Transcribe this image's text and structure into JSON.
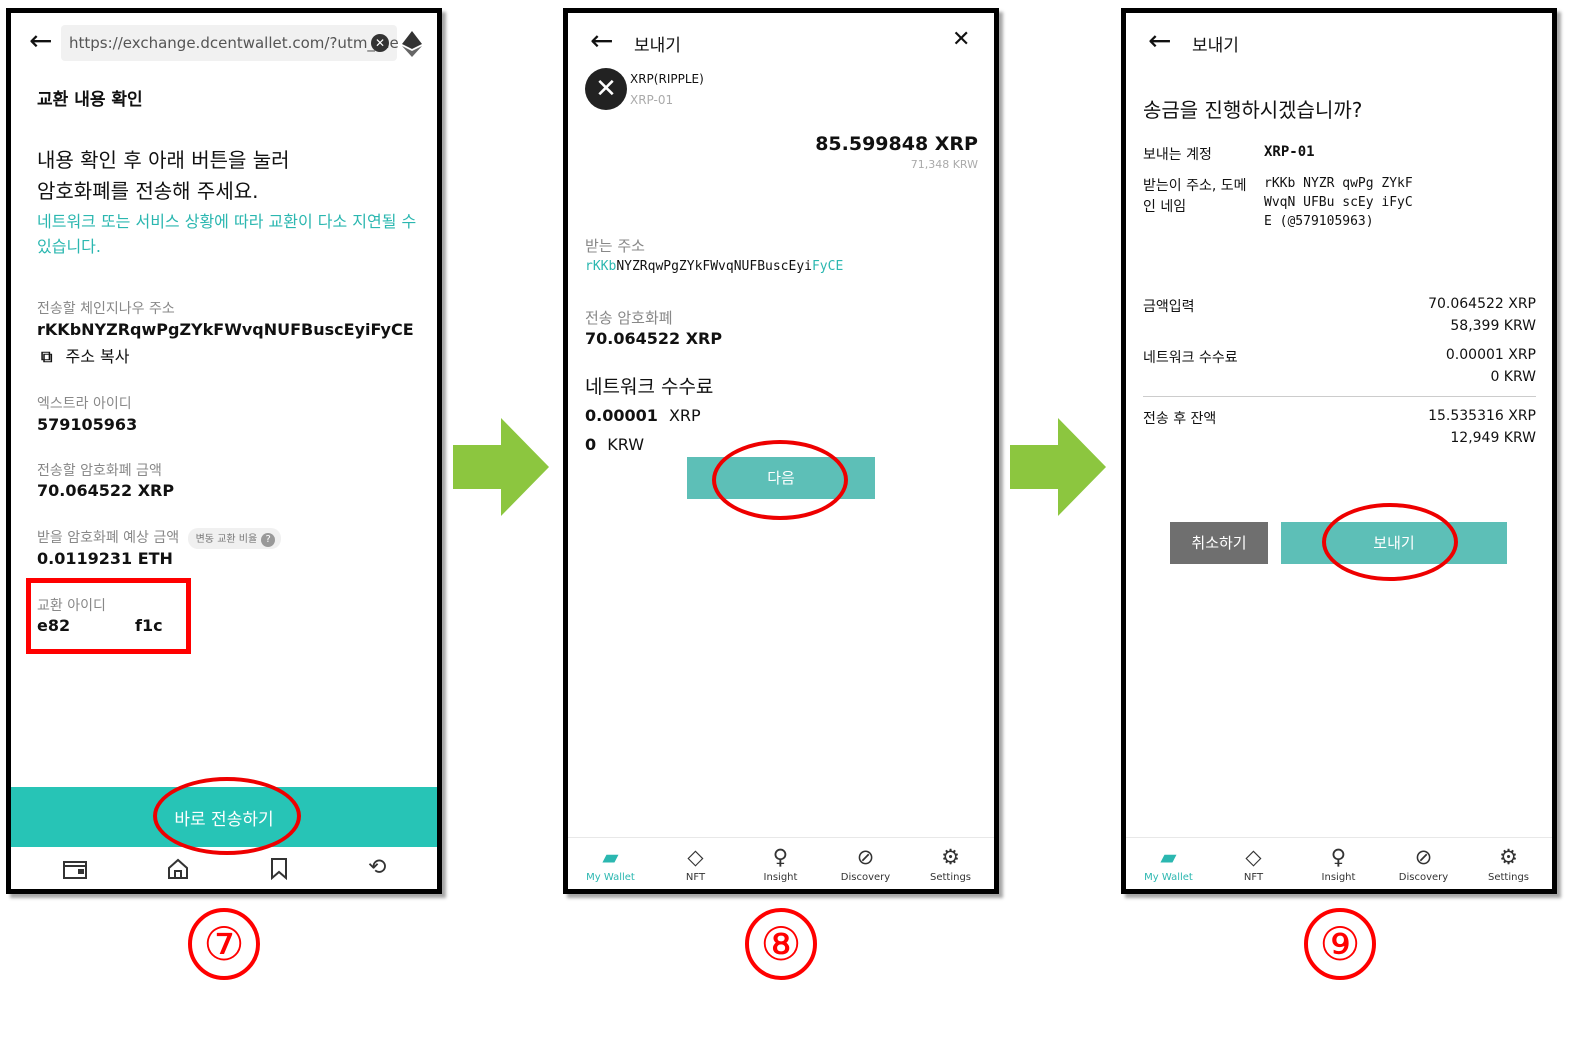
{
  "phone7": {
    "url": "https://exchange.dcentwallet.com/?utm_me",
    "title": "교환 내용 확인",
    "headline_line1": "내용 확인 후 아래 버튼을 눌러",
    "headline_line2": "암호화폐를 전송해 주세요.",
    "note": "네트워크 또는 서비스 상황에 따라 교환이 다소 지연될 수 있습니다.",
    "address_label": "전송할 체인지나우 주소",
    "address_value": "rKKbNYZRqwPgZYkFWvqNUFBuscEyiFyCE",
    "copy_label": "주소 복사",
    "extra_id_label": "엑스트라 아이디",
    "extra_id_value": "579105963",
    "send_amount_label": "전송할 암호화폐 금액",
    "send_amount_value": "70.064522 XRP",
    "receive_label": "받을 암호화폐 예상 금액",
    "rate_badge": "변동 교환 비율",
    "receive_value": "0.0119231 ETH",
    "exchange_id_label": "교환 아이디",
    "exchange_id_start": "e82",
    "exchange_id_end": "f1c",
    "send_button": "바로 전송하기"
  },
  "phone8": {
    "title": "보내기",
    "coin_name": "XRP(RIPPLE)",
    "account": "XRP-01",
    "balance": "85.599848 XRP",
    "balance_krw": "71,348 KRW",
    "recv_label": "받는 주소",
    "recv_addr_head": "rKKb",
    "recv_addr_mid": "NYZRqwPgZYkFWvqNUFBuscEyi",
    "recv_addr_tail": "FyCE",
    "crypto_label": "전송 암호화폐",
    "crypto_value": "70.064522 XRP",
    "fee_title": "네트워크 수수료",
    "fee_amount": "0.00001",
    "fee_unit": "XRP",
    "fee_krw_amount": "0",
    "fee_krw_unit": "KRW",
    "next_button": "다음"
  },
  "phone9": {
    "title": "보내기",
    "question": "송금을 진행하시겠습니까?",
    "from_label": "보내는 계정",
    "from_value": "XRP-01",
    "to_label_1": "받는이 주소, 도메",
    "to_label_2": "인 네임",
    "to_value_1": "rKKb NYZR qwPg ZYkF",
    "to_value_2": "WvqN UFBu scEy iFyC",
    "to_value_3": "E (@579105963)",
    "amount_label": "금액입력",
    "amount_xrp": "70.064522 XRP",
    "amount_krw": "58,399 KRW",
    "fee_label": "네트워크 수수료",
    "fee_xrp": "0.00001 XRP",
    "fee_krw": "0 KRW",
    "balance_label": "전송 후 잔액",
    "balance_xrp": "15.535316 XRP",
    "balance_krw": "12,949 KRW",
    "cancel_button": "취소하기",
    "send_button": "보내기"
  },
  "tabs": [
    "My Wallet",
    "NFT",
    "Insight",
    "Discovery",
    "Settings"
  ],
  "steps": [
    "⑦",
    "⑧",
    "⑨"
  ],
  "colors": {
    "accent": "#2bb7b0",
    "arrow": "#8cc63f",
    "highlight": "#ff0000"
  }
}
